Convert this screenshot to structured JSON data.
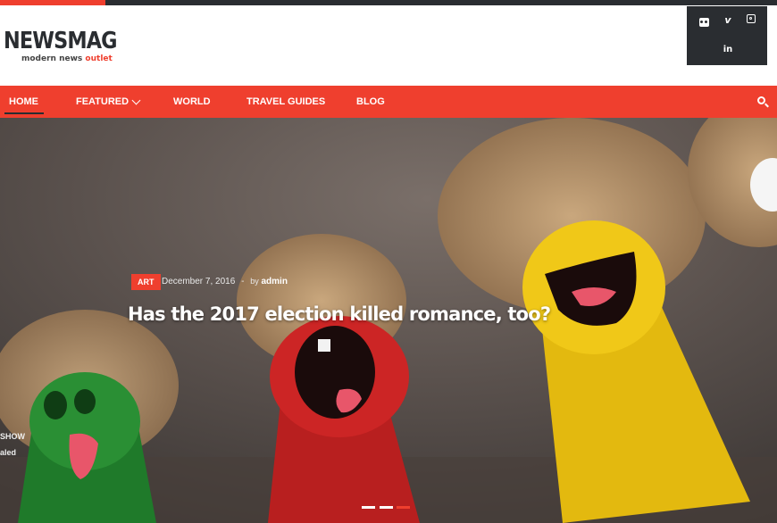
{
  "logo": {
    "title": "NEWSMAG",
    "tagline_main": "modern news",
    "tagline_accent": "outlet"
  },
  "social": {
    "flickr": "flickr-icon",
    "vimeo": "vimeo-icon",
    "instagram": "instagram-icon",
    "linkedin": "linkedin-icon"
  },
  "nav": {
    "items": [
      "HOME",
      "FEATURED",
      "WORLD",
      "TRAVEL GUIDES",
      "BLOG"
    ],
    "active": "HOME"
  },
  "hero": {
    "category": "ART",
    "date": "December 7, 2016",
    "separator": "-",
    "by": "by",
    "author": "admin",
    "headline": "Has the 2017 election killed romance, too?",
    "side_text_1": "SHOW",
    "side_text_2": "aled"
  },
  "colors": {
    "accent": "#ef3f2e",
    "dark": "#2a2d31"
  }
}
